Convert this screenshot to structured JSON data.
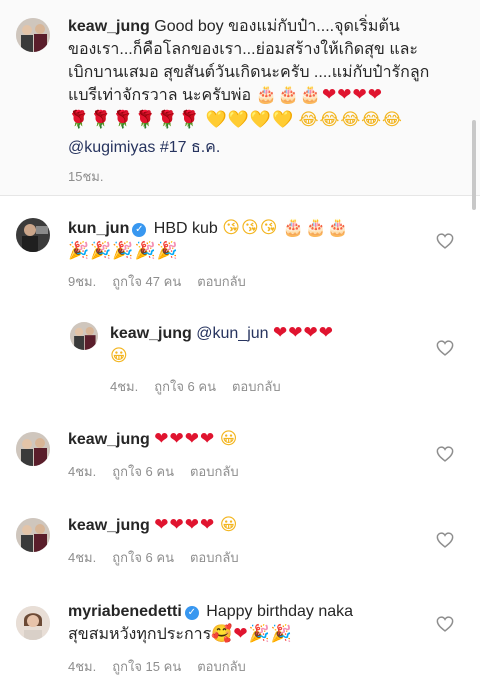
{
  "caption": {
    "username": "keaw_jung",
    "text_line1": "Good boy  ของแม่กับป๋า....จุดเริ่มต้น",
    "text_line2": "ของเรา...ก็คือโลกของเรา...ย่อมสร้างให้เกิดสุข และ",
    "text_line3": "เบิกบานเสมอ สุขสันต์วันเกิดนะครับ ....แม่กับป๋ารักลูก",
    "text_line4": "แบรีเท่าจักรวาล  นะครับพ่อ",
    "emoji_line4": "🎂🎂🎂❤❤❤❤",
    "emoji_line5a": "🌹🌹🌹🌹🌹🌹",
    "emoji_line5b": "💛💛💛💛",
    "emoji_line5c": "😂😂😂😂😂",
    "mention": "@kugimiyas",
    "date_tag": "#17 ธ.ค.",
    "time": "15ชม."
  },
  "comments": [
    {
      "username": "kun_jun",
      "verified": true,
      "text": "HBD kub",
      "emoji_a": "😘😘😘",
      "emoji_b": "🎂🎂🎂",
      "emoji_line2": "🎉🎉🎉🎉🎉",
      "time": "9ชม.",
      "likes": "ถูกใจ 47 คน",
      "reply": "ตอบกลับ"
    },
    {
      "username": "keaw_jung",
      "mention": "@kun_jun",
      "emoji_a": "❤❤❤❤",
      "emoji_line2": "😀",
      "time": "4ชม.",
      "likes": "ถูกใจ 6 คน",
      "reply": "ตอบกลับ"
    },
    {
      "username": "keaw_jung",
      "emoji_a": "❤❤❤❤",
      "emoji_b": "😀",
      "time": "4ชม.",
      "likes": "ถูกใจ 6 คน",
      "reply": "ตอบกลับ"
    },
    {
      "username": "keaw_jung",
      "emoji_a": "❤❤❤❤",
      "emoji_b": "😀",
      "time": "4ชม.",
      "likes": "ถูกใจ 6 คน",
      "reply": "ตอบกลับ"
    },
    {
      "username": "myriabenedetti",
      "verified": true,
      "text": "Happy birthday naka",
      "text_line2": "สุขสมหวังทุกประการ",
      "emoji_line2": "🥰❤🎉🎉",
      "time": "4ชม.",
      "likes": "ถูกใจ 15 คน",
      "reply": "ตอบกลับ"
    }
  ],
  "colors": {
    "heart": "#e0142f",
    "verified": "#3897f0",
    "meta": "#8e8e8e",
    "mention": "#27345f"
  },
  "icons": {
    "like": "heart-outline-icon",
    "verified": "verified-badge-icon"
  }
}
